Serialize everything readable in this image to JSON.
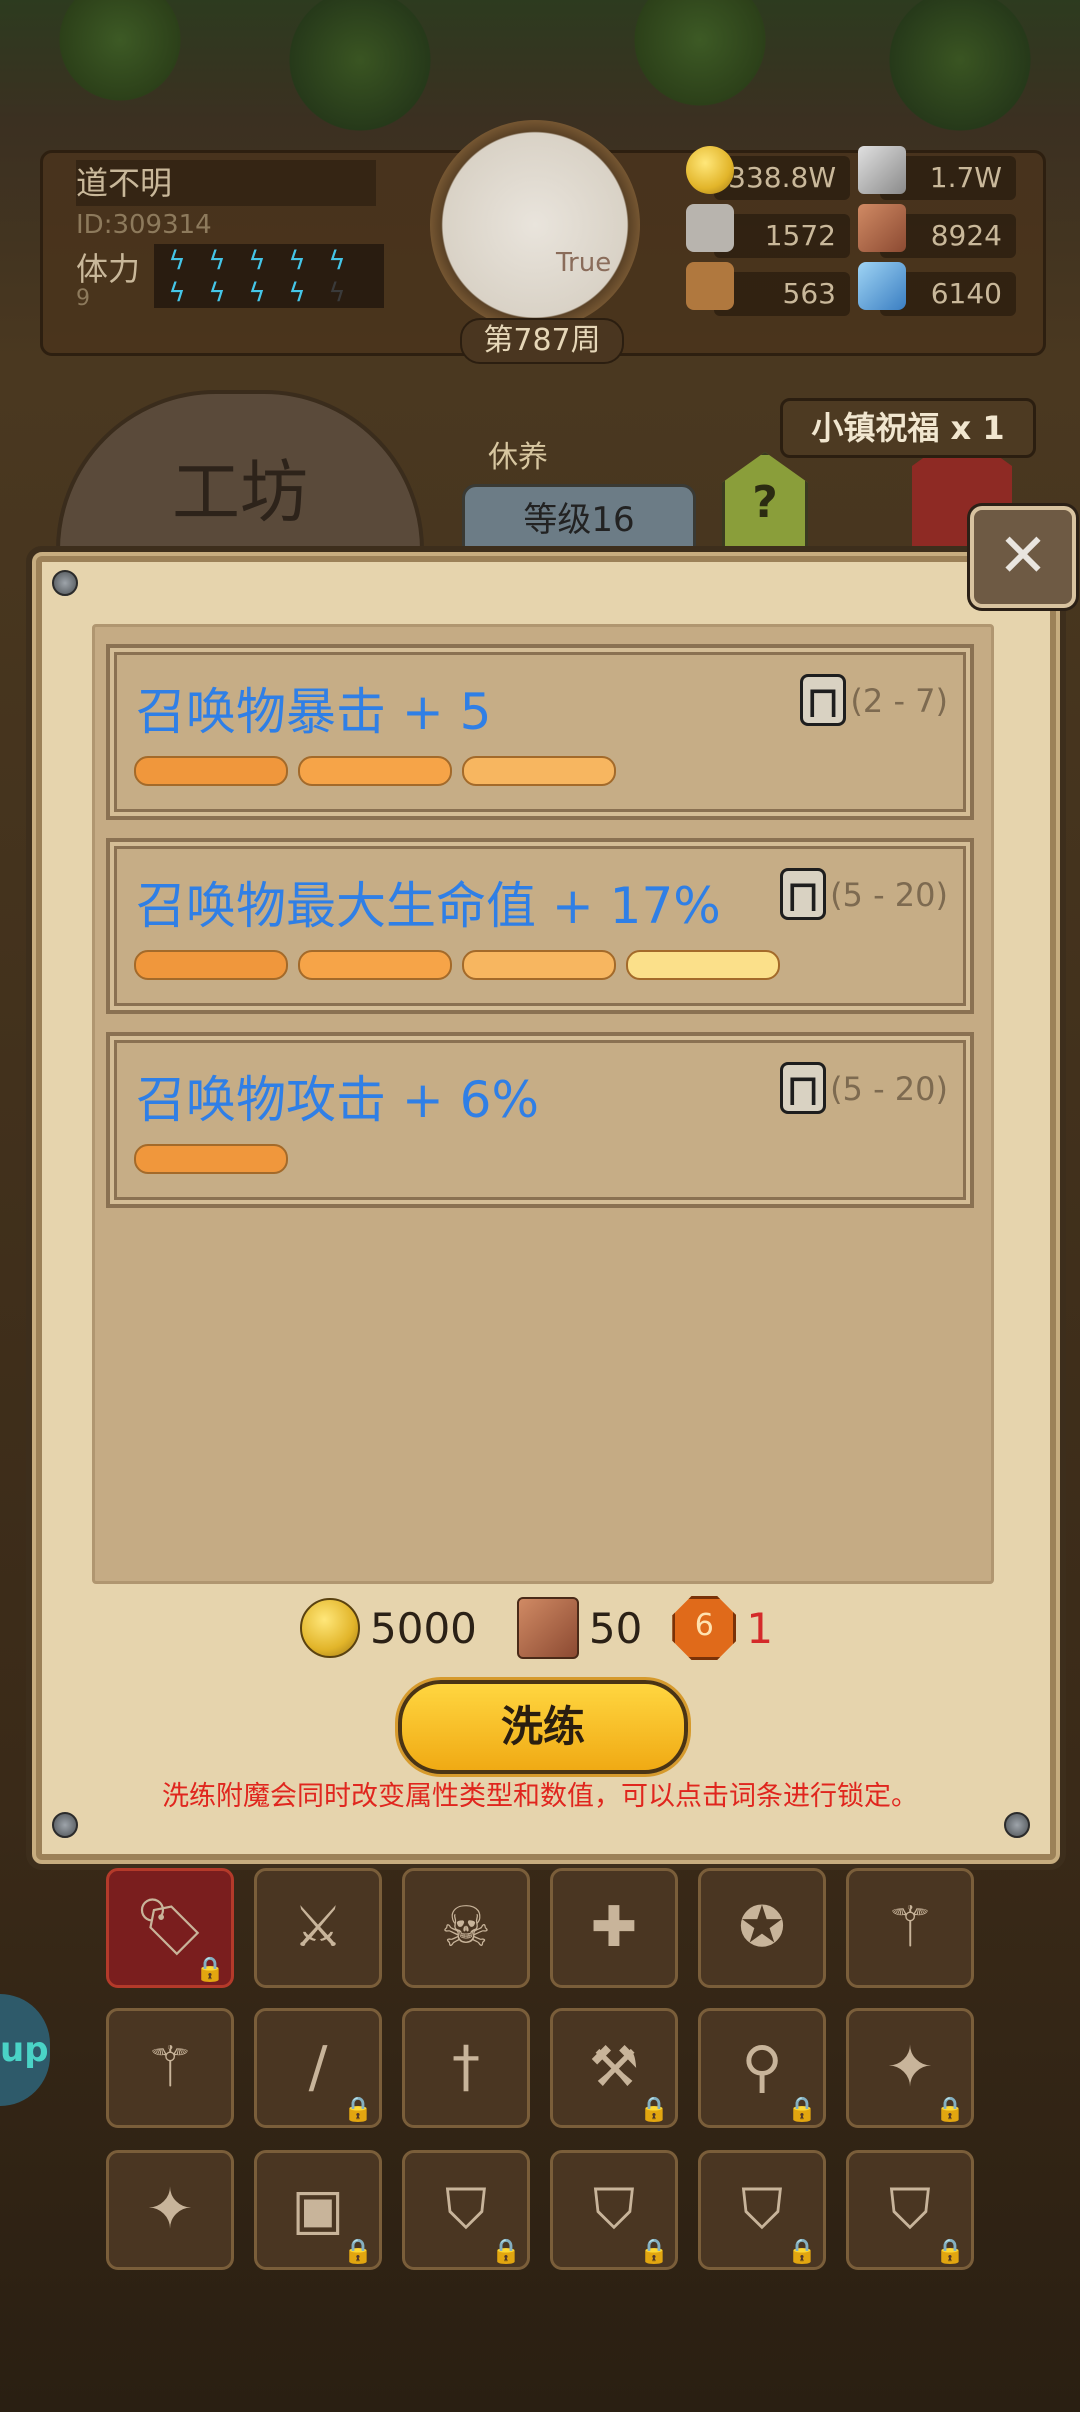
{
  "player": {
    "name": "道不明",
    "id": "ID:309314",
    "stamina_label": "体力",
    "stamina_value": "9",
    "avatar_text": "True",
    "week": "第787周"
  },
  "resources": [
    {
      "icon": "gold-coin-icon",
      "value": "338.8W"
    },
    {
      "icon": "iron-bar-icon",
      "value": "1.7W"
    },
    {
      "icon": "stone-icon",
      "value": "1572"
    },
    {
      "icon": "scroll-icon",
      "value": "8924"
    },
    {
      "icon": "wood-icon",
      "value": "563"
    },
    {
      "icon": "crystal-icon",
      "value": "6140"
    }
  ],
  "town": {
    "blessing": "小镇祝福 x 1",
    "workshop": "工坊",
    "rest": "休养",
    "level": "等级16",
    "help": "?"
  },
  "affixes": [
    {
      "name": "召唤物暴击 + 5",
      "range": "(2 - 7)",
      "pips": 3
    },
    {
      "name": "召唤物最大生命值 + 17%",
      "range": "(5 - 20)",
      "pips": 4
    },
    {
      "name": "召唤物攻击 + 6%",
      "range": "(5 - 20)",
      "pips": 1
    }
  ],
  "cost": {
    "gold": "5000",
    "scroll": "50",
    "gem_label": "6",
    "gem": "1"
  },
  "reforge_button": "洗练",
  "hint": "洗练附魔会同时改变属性类型和数值，可以点击词条进行锁定。",
  "side_tab": "up",
  "colors": {
    "affix_text": "#2f7fe6",
    "hint_text": "#e0261e",
    "pip_1": "#f0973c",
    "pip_2": "#f6a448",
    "pip_3": "#f7b660",
    "pip_4": "#fbe08a"
  }
}
